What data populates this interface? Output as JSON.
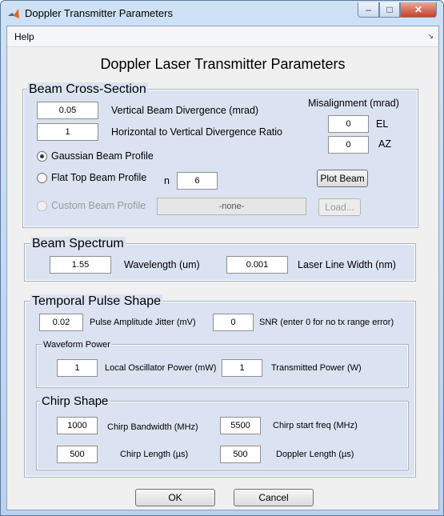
{
  "window": {
    "title": "Doppler Transmitter Parameters",
    "app_icon": "matlab-icon"
  },
  "menu": {
    "help": "Help"
  },
  "main_title": "Doppler Laser Transmitter Parameters",
  "beam_cross_section": {
    "title": "Beam Cross-Section",
    "vertical_divergence": {
      "value": "0.05",
      "label": "Vertical Beam Divergence (mrad)"
    },
    "divergence_ratio": {
      "value": "1",
      "label": "Horizontal to Vertical Divergence Ratio"
    },
    "misalignment": {
      "label": "Misalignment (mrad)",
      "el_value": "0",
      "el_label": "EL",
      "az_value": "0",
      "az_label": "AZ"
    },
    "gaussian": {
      "label": "Gaussian Beam Profile",
      "selected": true
    },
    "flat_top": {
      "label": "Flat Top Beam Profile",
      "n_label": "n",
      "n_value": "6"
    },
    "plot_beam": "Plot Beam",
    "custom": {
      "label": "Custom Beam Profile",
      "file": "-none-",
      "load": "Load..."
    }
  },
  "beam_spectrum": {
    "title": "Beam Spectrum",
    "wavelength": {
      "value": "1.55",
      "label": "Wavelength (um)"
    },
    "line_width": {
      "value": "0.001",
      "label": "Laser Line Width (nm)"
    }
  },
  "temporal": {
    "title": "Temporal Pulse Shape",
    "jitter": {
      "value": "0.02",
      "label": "Pulse Amplitude Jitter (mV)"
    },
    "snr": {
      "value": "0",
      "label": "SNR (enter 0 for no tx range error)"
    },
    "waveform_power": {
      "title": "Waveform Power",
      "lo_power": {
        "value": "1",
        "label": "Local Oscillator Power (mW)"
      },
      "tx_power": {
        "value": "1",
        "label": "Transmitted Power (W)"
      }
    },
    "chirp": {
      "title": "Chirp Shape",
      "bandwidth": {
        "value": "1000",
        "label": "Chirp Bandwidth (MHz)"
      },
      "start_freq": {
        "value": "5500",
        "label": "Chirp start freq (MHz)"
      },
      "length": {
        "value": "500",
        "label": "Chirp Length (µs)"
      },
      "doppler_length": {
        "value": "500",
        "label": "Doppler Length (µs)"
      }
    }
  },
  "buttons": {
    "ok": "OK",
    "cancel": "Cancel"
  }
}
